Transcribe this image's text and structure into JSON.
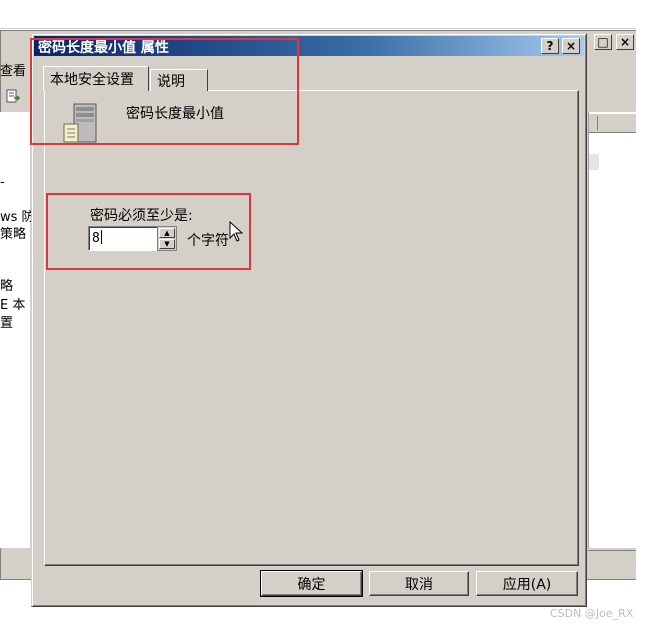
{
  "background_window": {
    "menu_fragment": "查看",
    "left_pane_fragments": [
      "ws 防",
      "策略",
      "略",
      "E 本",
      "置"
    ],
    "titlebar_buttons": [
      "□",
      "×"
    ]
  },
  "dialog": {
    "title": "密码长度最小值 属性",
    "title_buttons": {
      "help": "?",
      "close": "×"
    },
    "tabs": [
      {
        "label": "本地安全设置",
        "active": true
      },
      {
        "label": "说明",
        "active": false
      }
    ],
    "policy": {
      "icon": "server-icon",
      "name": "密码长度最小值"
    },
    "setting": {
      "label": "密码必须至少是:",
      "value": "8",
      "unit": "个字符"
    },
    "buttons": {
      "ok": "确定",
      "cancel": "取消",
      "apply": "应用(A)"
    }
  },
  "colors": {
    "titlebar_start": "#0a246a",
    "titlebar_end": "#a6caf0",
    "face": "#d4d0c8",
    "highlight_box": "#e3333b"
  },
  "watermark": "CSDN @Joe_RX"
}
